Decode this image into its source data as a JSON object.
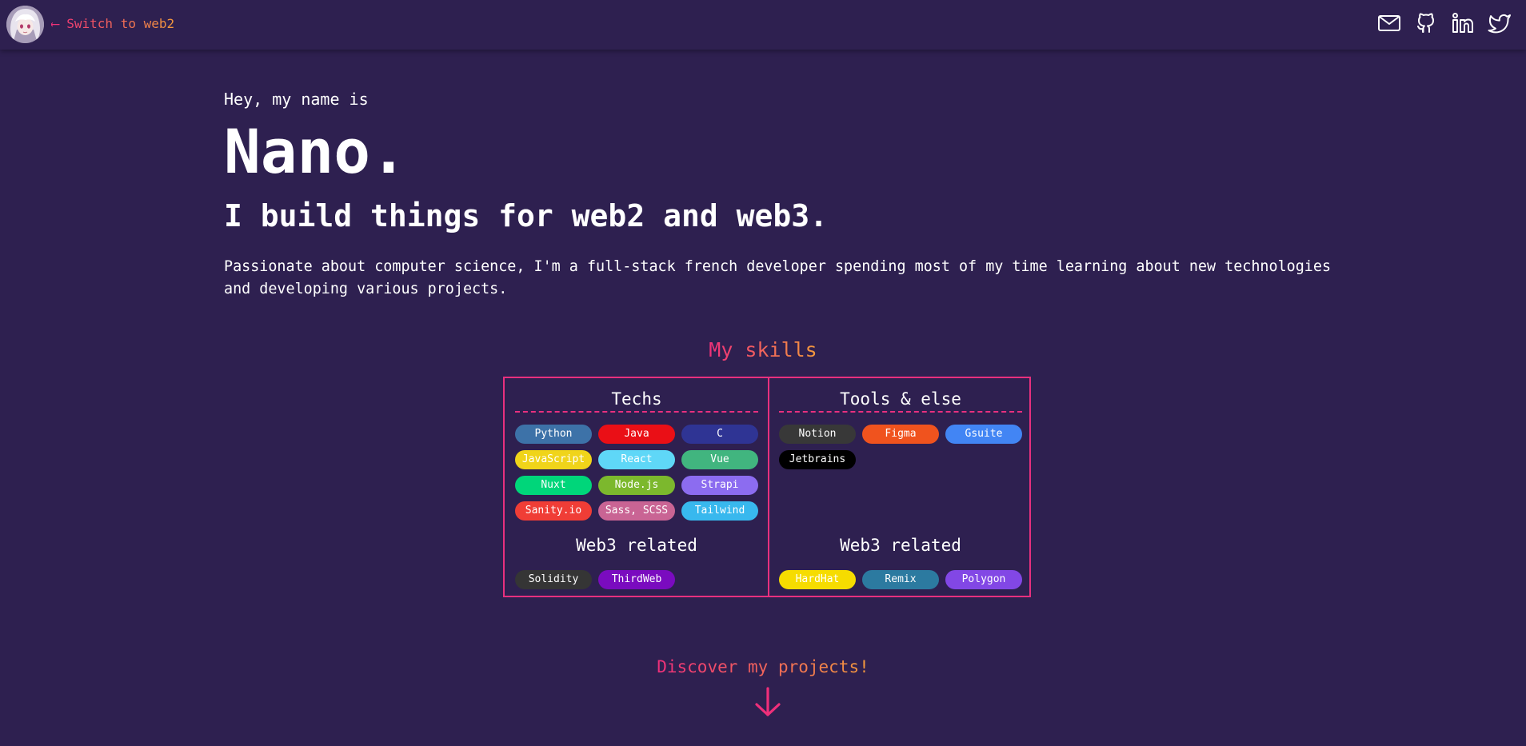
{
  "header": {
    "switch_label": "⟵ Switch to web2",
    "avatar_icon": "anime-avatar",
    "social_icons": [
      "mail-icon",
      "github-icon",
      "linkedin-icon",
      "twitter-icon"
    ]
  },
  "intro": {
    "greeting": "Hey, my name is",
    "name": "Nano.",
    "tagline": "I build things for web2 and web3.",
    "bio": "Passionate about computer science, I'm a full-stack french developer spending most of my time learning about new technologies and developing various projects."
  },
  "skills": {
    "title": "My skills",
    "techs": {
      "title": "Techs",
      "items": [
        {
          "label": "Python",
          "color": "#3d72a8"
        },
        {
          "label": "Java",
          "color": "#ea0f16"
        },
        {
          "label": "C",
          "color": "#2f3494"
        },
        {
          "label": "JavaScript",
          "color": "#f0d41a"
        },
        {
          "label": "React",
          "color": "#5fd7f7"
        },
        {
          "label": "Vue",
          "color": "#41b57f"
        },
        {
          "label": "Nuxt",
          "color": "#00d67a"
        },
        {
          "label": "Node.js",
          "color": "#7cb82d"
        },
        {
          "label": "Strapi",
          "color": "#8c6cf0"
        },
        {
          "label": "Sanity.io",
          "color": "#f03d36"
        },
        {
          "label": "Sass, SCSS",
          "color": "#c96494"
        },
        {
          "label": "Tailwind",
          "color": "#38b8ee"
        }
      ],
      "web3_title": "Web3 related",
      "web3_items": [
        {
          "label": "Solidity",
          "color": "#353535"
        },
        {
          "label": "ThirdWeb",
          "color": "#7a0bbf"
        }
      ]
    },
    "tools": {
      "title": "Tools & else",
      "items": [
        {
          "label": "Notion",
          "color": "#383838"
        },
        {
          "label": "Figma",
          "color": "#f0531e"
        },
        {
          "label": "Gsuite",
          "color": "#4285f4"
        },
        {
          "label": "Jetbrains",
          "color": "#000000"
        }
      ],
      "web3_title": "Web3 related",
      "web3_items": [
        {
          "label": "HardHat",
          "color": "#f6dc00"
        },
        {
          "label": "Remix",
          "color": "#2c7aa0"
        },
        {
          "label": "Polygon",
          "color": "#8247e5"
        }
      ]
    }
  },
  "footer": {
    "discover_label": "Discover my projects!",
    "arrow_icon": "arrow-down-icon"
  },
  "colors": {
    "background": "#2e2050",
    "accent_pink": "#ef2f7a",
    "accent_orange": "#f39a3c"
  }
}
